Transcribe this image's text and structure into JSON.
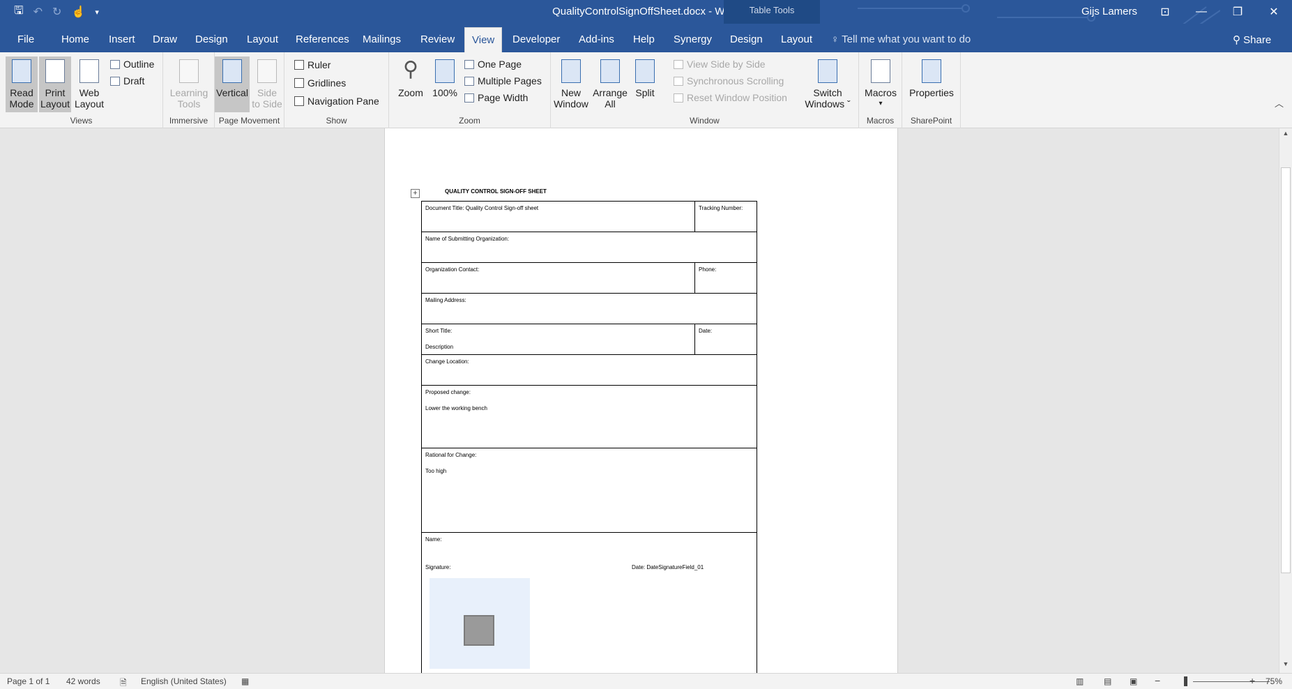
{
  "titlebar": {
    "document_title": "QualityControlSignOffSheet.docx  -  Word",
    "context_tab_header": "Table Tools",
    "user_name": "Gijs Lamers"
  },
  "tabs": [
    "File",
    "Home",
    "Insert",
    "Draw",
    "Design",
    "Layout",
    "References",
    "Mailings",
    "Review",
    "View",
    "Developer",
    "Add-ins",
    "Help",
    "Synergy",
    "Design",
    "Layout"
  ],
  "active_tab": "View",
  "tell_me": "Tell me what you want to do",
  "share_label": "Share",
  "ribbon": {
    "views": {
      "label": "Views",
      "read_mode": [
        "Read",
        "Mode"
      ],
      "print_layout": [
        "Print",
        "Layout"
      ],
      "web_layout": [
        "Web",
        "Layout"
      ],
      "outline": "Outline",
      "draft": "Draft"
    },
    "immersive": {
      "label": "Immersive",
      "learning_tools": [
        "Learning",
        "Tools"
      ]
    },
    "page_movement": {
      "label": "Page Movement",
      "vertical": "Vertical",
      "side_to_side": [
        "Side",
        "to Side"
      ]
    },
    "show": {
      "label": "Show",
      "ruler": "Ruler",
      "gridlines": "Gridlines",
      "navigation_pane": "Navigation Pane"
    },
    "zoom": {
      "label": "Zoom",
      "zoom": "Zoom",
      "hundred": "100%",
      "one_page": "One Page",
      "multiple_pages": "Multiple Pages",
      "page_width": "Page Width"
    },
    "window": {
      "label": "Window",
      "new_window": [
        "New",
        "Window"
      ],
      "arrange_all": [
        "Arrange",
        "All"
      ],
      "split": "Split",
      "view_side_by_side": "View Side by Side",
      "synchronous_scrolling": "Synchronous Scrolling",
      "reset_window_position": "Reset Window Position",
      "switch_windows": [
        "Switch",
        "Windows ˇ"
      ]
    },
    "macros": {
      "label": "Macros",
      "macros": "Macros"
    },
    "sharepoint": {
      "label": "SharePoint",
      "properties": "Properties"
    }
  },
  "document": {
    "heading": "QUALITY CONTROL SIGN-OFF SHEET",
    "document_title_field": "Document Title: Quality Control Sign-off sheet",
    "tracking_number": "Tracking Number:",
    "submitting_org": "Name of Submitting Organization:",
    "org_contact": "Organization Contact:",
    "phone": "Phone:",
    "mailing_address": "Mailing Address:",
    "short_title": "Short Title:",
    "description": "Description",
    "date": "Date:",
    "change_location": "Change Location:",
    "proposed_change": "Proposed change:",
    "proposed_change_value": "Lower the working bench",
    "rational": "Rational for Change:",
    "rational_value": "Too high",
    "name": "Name:",
    "signature": "Signature:",
    "date_signature": "Date: DateSignatureField_01"
  },
  "statusbar": {
    "page": "Page 1 of 1",
    "words": "42 words",
    "language": "English (United States)",
    "zoom": "75%"
  }
}
